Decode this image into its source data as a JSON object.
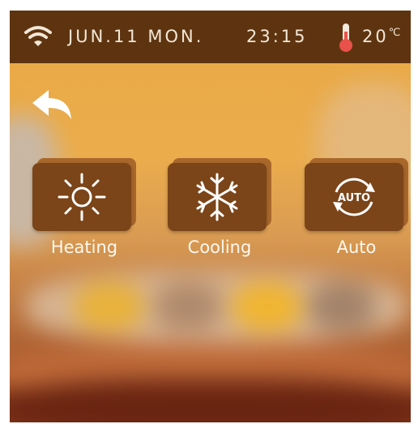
{
  "status_bar": {
    "date": "JUN.11 MON.",
    "time": "23:15",
    "temperature": "20",
    "temperature_unit": "℃",
    "icons": [
      "wifi-icon",
      "thermometer-icon"
    ]
  },
  "navigation": {
    "back_icon": "back-arrow-icon"
  },
  "modes": [
    {
      "label": "Heating",
      "icon": "sun-icon"
    },
    {
      "label": "Cooling",
      "icon": "snowflake-icon"
    },
    {
      "label": "Auto",
      "icon": "auto-cycle-icon",
      "icon_text": "AUTO"
    }
  ],
  "colors": {
    "status_bar_bg": "#5e3410",
    "tile_face": "#7b4519",
    "tile_shadow": "#a8672b",
    "background_top": "#e9a844",
    "thermometer": "#e8524a"
  }
}
